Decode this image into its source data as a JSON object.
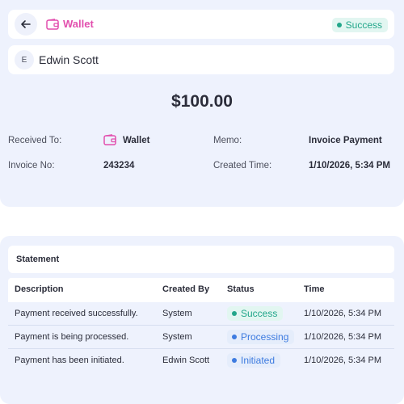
{
  "header": {
    "title": "Wallet",
    "status": "Success",
    "back_icon": "arrow-left-icon",
    "wallet_icon": "wallet-icon",
    "accent_color": "#e24fae"
  },
  "user": {
    "avatar_initial": "E",
    "name": "Edwin Scott"
  },
  "amount": "$100.00",
  "details": {
    "received_to_label": "Received To:",
    "received_to_value": "Wallet",
    "memo_label": "Memo:",
    "memo_value": "Invoice Payment",
    "invoice_label": "Invoice No:",
    "invoice_value": "243234",
    "created_label": "Created Time:",
    "created_value": "1/10/2026, 5:34 PM"
  },
  "statement": {
    "title": "Statement",
    "columns": [
      "Description",
      "Created By",
      "Status",
      "Time"
    ],
    "rows": [
      {
        "description": "Payment received successfully.",
        "created_by": "System",
        "status": "Success",
        "time": "1/10/2026, 5:34 PM"
      },
      {
        "description": "Payment is being processed.",
        "created_by": "System",
        "status": "Processing",
        "time": "1/10/2026, 5:34 PM"
      },
      {
        "description": "Payment has been initiated.",
        "created_by": "Edwin Scott",
        "status": "Initiated",
        "time": "1/10/2026, 5:34 PM"
      }
    ]
  },
  "colors": {
    "success": "#22a68a",
    "processing": "#3d7be0",
    "initiated": "#3d7be0",
    "panel_bg": "#eef2fd"
  }
}
